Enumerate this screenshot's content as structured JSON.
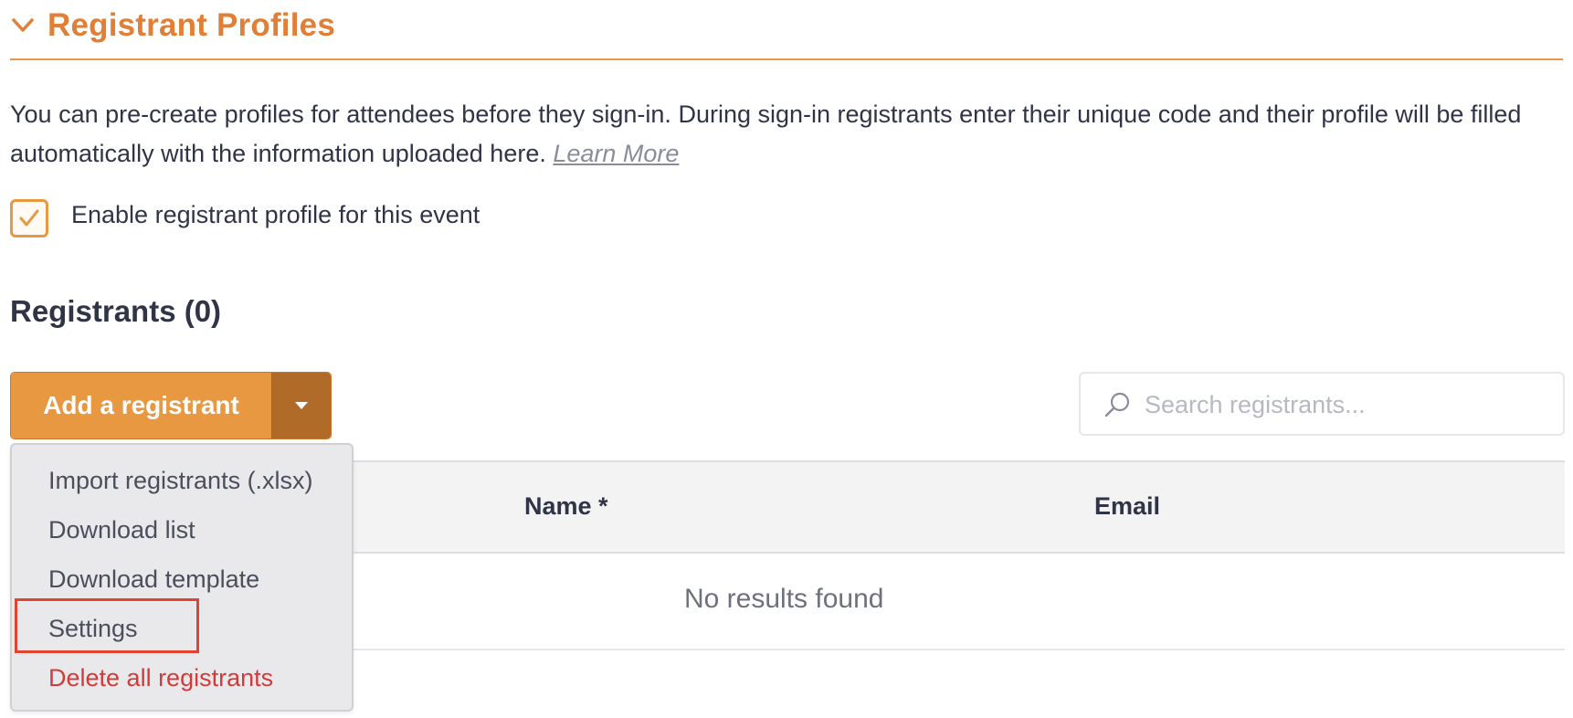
{
  "section": {
    "title": "Registrant Profiles"
  },
  "description": {
    "text": "You can pre-create profiles for attendees before they sign-in. During sign-in registrants enter their unique code and their profile will be filled automatically with the information uploaded here.",
    "learn_more": "Learn More"
  },
  "enable_checkbox": {
    "label": "Enable registrant profile for this event",
    "checked": true
  },
  "registrants": {
    "heading": "Registrants (0)"
  },
  "add_button": {
    "label": "Add a registrant"
  },
  "search": {
    "placeholder": "Search registrants...",
    "value": ""
  },
  "dropdown": {
    "items": [
      {
        "label": "Import registrants (.xlsx)"
      },
      {
        "label": "Download list"
      },
      {
        "label": "Download template"
      },
      {
        "label": "Settings",
        "highlighted": true
      },
      {
        "label": "Delete all registrants",
        "danger": true
      }
    ]
  },
  "table": {
    "columns": [
      "Name *",
      "Email"
    ],
    "empty_message": "No results found"
  },
  "colors": {
    "accent": "#e79840",
    "accent_dark": "#b06b28",
    "title_orange": "#e07f35",
    "danger": "#d33a3a",
    "highlight": "#e0442f"
  }
}
